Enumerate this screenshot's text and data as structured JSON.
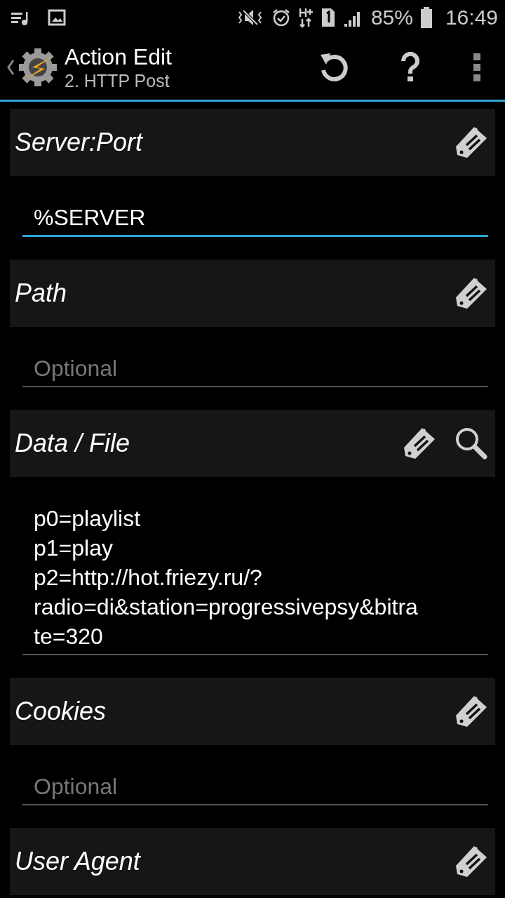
{
  "status_bar": {
    "battery": "85%",
    "time": "16:49"
  },
  "action_bar": {
    "title": "Action Edit",
    "subtitle": "2. HTTP Post"
  },
  "sections": [
    {
      "label": "Server:Port",
      "search": false,
      "field": {
        "value_lines": [
          "%SERVER"
        ],
        "focused": true
      }
    },
    {
      "label": "Path",
      "search": false,
      "field": {
        "placeholder": "Optional",
        "focused": false
      }
    },
    {
      "label": "Data / File",
      "search": true,
      "field": {
        "value_lines": [
          "p0=playlist",
          "p1=play",
          "p2=http://hot.friezy.ru/?",
          "radio=di&station=progressivepsy&bitra",
          "te=320"
        ],
        "focused": false
      }
    },
    {
      "label": "Cookies",
      "search": false,
      "field": {
        "placeholder": "Optional",
        "focused": false
      }
    },
    {
      "label": "User Agent",
      "search": false
    }
  ]
}
